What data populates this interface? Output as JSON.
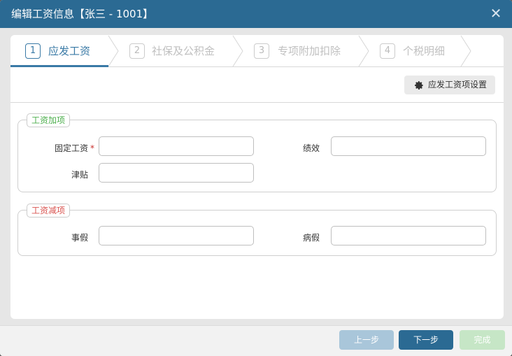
{
  "dialog": {
    "title": "编辑工资信息【张三 - 1001】"
  },
  "steps": [
    {
      "num": "1",
      "label": "应发工资",
      "active": true
    },
    {
      "num": "2",
      "label": "社保及公积金",
      "active": false
    },
    {
      "num": "3",
      "label": "专项附加扣除",
      "active": false
    },
    {
      "num": "4",
      "label": "个税明细",
      "active": false
    }
  ],
  "toolbar": {
    "settings_label": "应发工资项设置"
  },
  "groups": {
    "additions": {
      "title": "工资加项",
      "fields": {
        "fixed_salary": {
          "label": "固定工资",
          "required": "*",
          "value": ""
        },
        "performance": {
          "label": "绩效",
          "value": ""
        },
        "allowance": {
          "label": "津贴",
          "value": ""
        }
      }
    },
    "deductions": {
      "title": "工资减项",
      "fields": {
        "personal_leave": {
          "label": "事假",
          "value": ""
        },
        "sick_leave": {
          "label": "病假",
          "value": ""
        }
      }
    }
  },
  "footer": {
    "prev_label": "上一步",
    "next_label": "下一步",
    "done_label": "完成"
  },
  "colors": {
    "primary": "#2b6a93",
    "accent": "#3a7aa6",
    "green": "#4cae4c",
    "red": "#d9534f"
  }
}
